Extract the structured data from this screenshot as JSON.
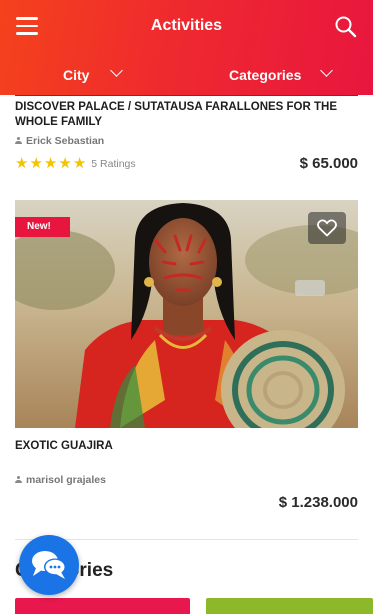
{
  "header": {
    "title": "Activities",
    "menu_icon": "hamburger-menu-icon",
    "search_icon": "search-icon",
    "filters": [
      {
        "label": "City"
      },
      {
        "label": "Categories"
      }
    ],
    "gradient_colors": [
      "#f4421c",
      "#e8163e"
    ]
  },
  "activities": [
    {
      "title": "DISCOVER PALACE / SUTATAUSA FARALLONES FOR THE WHOLE FAMILY",
      "author": "Erick Sebastian",
      "rating_stars": 5,
      "ratings_label": "5 Ratings",
      "price": "$ 65.000"
    },
    {
      "badge": "New!",
      "title": "EXOTIC GUAJIRA",
      "author": "marisol grajales",
      "price": "$ 1.238.000"
    }
  ],
  "categories_section": {
    "title": "Categories",
    "tile_colors": [
      "#e8174d",
      "#8cb82a"
    ]
  },
  "colors": {
    "accent": "#e8163e",
    "star": "#f5c400",
    "chat": "#1b74e6"
  }
}
